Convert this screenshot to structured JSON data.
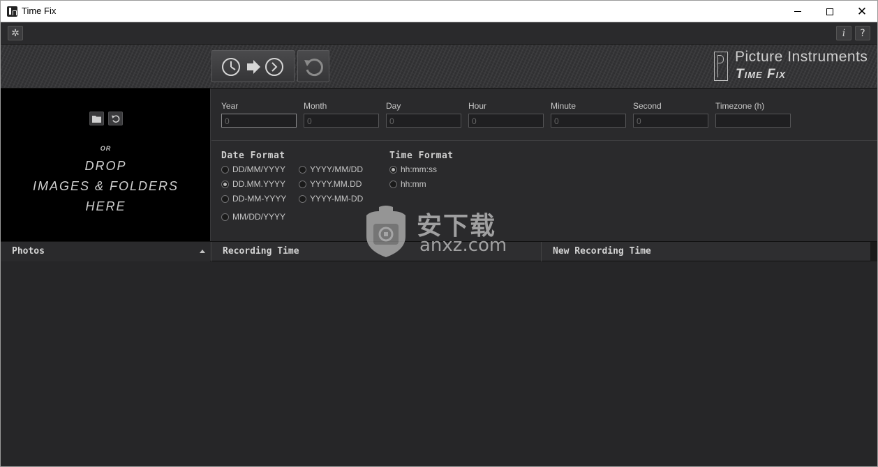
{
  "window": {
    "title": "Time Fix"
  },
  "toolbar": {
    "info_label": "i",
    "help_label": "?"
  },
  "brand": {
    "line1": "Picture Instruments",
    "line2": "Time Fix"
  },
  "dropzone": {
    "or": "OR",
    "line1": "DROP",
    "line2": "IMAGES & FOLDERS",
    "line3": "HERE"
  },
  "fields": [
    {
      "label": "Year",
      "value": "0"
    },
    {
      "label": "Month",
      "value": "0"
    },
    {
      "label": "Day",
      "value": "0"
    },
    {
      "label": "Hour",
      "value": "0"
    },
    {
      "label": "Minute",
      "value": "0"
    },
    {
      "label": "Second",
      "value": "0"
    },
    {
      "label": "Timezone (h)",
      "value": ""
    }
  ],
  "date_format": {
    "title": "Date Format",
    "options": [
      {
        "label": "DD/MM/YYYY",
        "selected": false
      },
      {
        "label": "YYYY/MM/DD",
        "selected": false
      },
      {
        "label": "DD.MM.YYYY",
        "selected": true
      },
      {
        "label": "YYYY.MM.DD",
        "selected": false
      },
      {
        "label": "DD-MM-YYYY",
        "selected": false
      },
      {
        "label": "YYYY-MM-DD",
        "selected": false
      },
      {
        "label": "MM/DD/YYYY",
        "selected": false
      }
    ]
  },
  "time_format": {
    "title": "Time Format",
    "options": [
      {
        "label": "hh:mm:ss",
        "selected": true
      },
      {
        "label": "hh:mm",
        "selected": false
      }
    ]
  },
  "table": {
    "columns": [
      "Photos",
      "Recording Time",
      "New Recording Time"
    ]
  },
  "watermark": {
    "cn": "安下载",
    "en": "anxz.com"
  }
}
